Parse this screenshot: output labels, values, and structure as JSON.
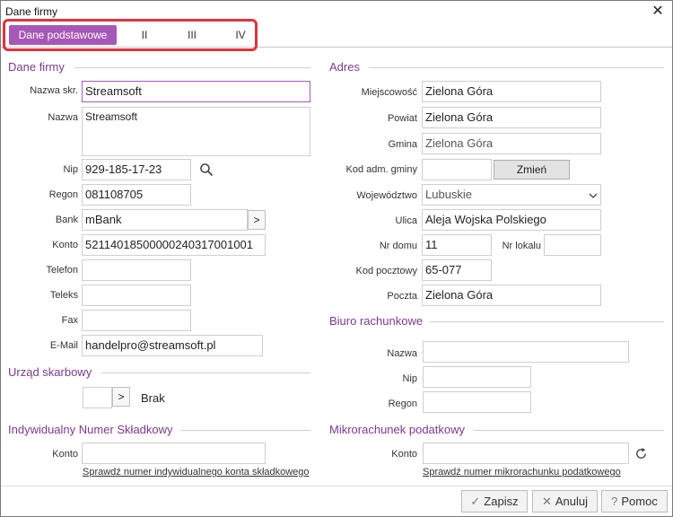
{
  "window": {
    "title": "Dane firmy"
  },
  "tabs": [
    {
      "label": "Dane podstawowe",
      "active": true
    },
    {
      "label": "II"
    },
    {
      "label": "III"
    },
    {
      "label": "IV"
    }
  ],
  "dane_firmy": {
    "section": "Dane firmy",
    "nazwa_skr": {
      "label": "Nazwa skr.",
      "value": "Streamsoft"
    },
    "nazwa": {
      "label": "Nazwa",
      "value": "Streamsoft"
    },
    "nip": {
      "label": "Nip",
      "value": "929-185-17-23"
    },
    "regon": {
      "label": "Regon",
      "value": "081108705"
    },
    "bank": {
      "label": "Bank",
      "value": "mBank",
      "button": ">"
    },
    "konto": {
      "label": "Konto",
      "value": "52114018500000240317001001"
    },
    "telefon": {
      "label": "Telefon",
      "value": ""
    },
    "teleks": {
      "label": "Teleks",
      "value": ""
    },
    "fax": {
      "label": "Fax",
      "value": ""
    },
    "email": {
      "label": "E-Mail",
      "value": "handelpro@streamsoft.pl"
    }
  },
  "urzad": {
    "section": "Urząd skarbowy",
    "button": ">",
    "value": "Brak"
  },
  "inps": {
    "section": "Indywidualny Numer Składkowy",
    "konto_label": "Konto",
    "konto_value": "",
    "link": "Sprawdź numer indywidualnego konta składkowego"
  },
  "adres": {
    "section": "Adres",
    "miejscowosc": {
      "label": "Miejscowość",
      "value": "Zielona Góra"
    },
    "powiat": {
      "label": "Powiat",
      "value": "Zielona Góra"
    },
    "gmina": {
      "label": "Gmina",
      "value": "Zielona Góra"
    },
    "kod_adm": {
      "label": "Kod adm. gminy",
      "value": "",
      "button": "Zmień"
    },
    "wojewodztwo": {
      "label": "Województwo",
      "value": "Lubuskie"
    },
    "ulica": {
      "label": "Ulica",
      "value": "Aleja Wojska Polskiego"
    },
    "nr_domu": {
      "label": "Nr domu",
      "value": "11"
    },
    "nr_lokalu": {
      "label": "Nr lokalu",
      "value": ""
    },
    "kod_pocztowy": {
      "label": "Kod pocztowy",
      "value": "65-077"
    },
    "poczta": {
      "label": "Poczta",
      "value": "Zielona Góra"
    }
  },
  "biuro": {
    "section": "Biuro rachunkowe",
    "nazwa": {
      "label": "Nazwa",
      "value": ""
    },
    "nip": {
      "label": "Nip",
      "value": ""
    },
    "regon": {
      "label": "Regon",
      "value": ""
    }
  },
  "mikro": {
    "section": "Mikrorachunek podatkowy",
    "konto_label": "Konto",
    "konto_value": "",
    "link": "Sprawdź numer mikrorachunku podatkowego"
  },
  "footer": {
    "zapisz": "Zapisz",
    "anuluj": "Anuluj",
    "pomoc": "Pomoc"
  },
  "icons": {
    "close": "close-icon",
    "search": "search-icon",
    "refresh": "refresh-icon",
    "dropdown": "chevron-down-icon"
  },
  "colors": {
    "accent": "#a758b6",
    "section_title": "#7a3a8c",
    "highlight": "#e0333d"
  }
}
